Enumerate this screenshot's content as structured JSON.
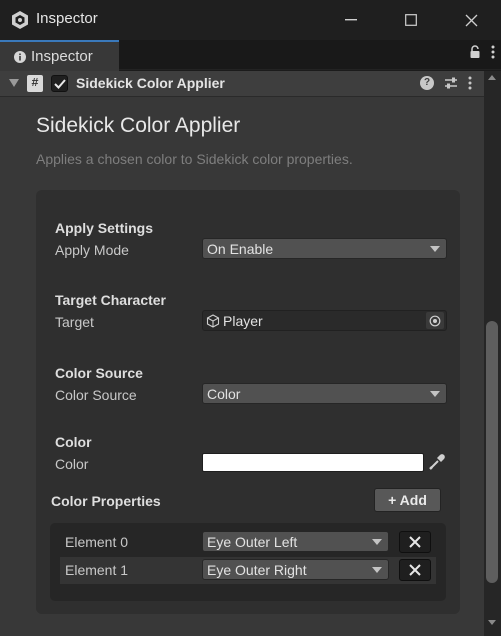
{
  "window": {
    "title": "Inspector",
    "icons": {
      "app": "unity-logo-icon",
      "minimize": "minimize-icon",
      "maximize": "maximize-icon",
      "close": "close-icon"
    }
  },
  "tabbar": {
    "tab_label": "Inspector",
    "tab_icon": "info-icon",
    "tools": [
      "lock-icon",
      "more-vertical-icon"
    ]
  },
  "component": {
    "name": "Sidekick Color Applier",
    "enabled": true,
    "script_icon_glyph": "#",
    "header_icons": [
      "help-icon",
      "preset-icon",
      "more-vertical-icon"
    ],
    "help_glyph": "?"
  },
  "editor": {
    "title": "Sidekick Color Applier",
    "description": "Applies a chosen color to Sidekick color properties.",
    "sections": {
      "apply_settings": {
        "title": "Apply Settings",
        "label": "Apply Mode",
        "value": "On Enable"
      },
      "target_character": {
        "title": "Target Character",
        "label": "Target",
        "value": "Player"
      },
      "color_source": {
        "title": "Color Source",
        "label": "Color Source",
        "value": "Color"
      },
      "color": {
        "title": "Color",
        "label": "Color",
        "swatch_color": "#ffffff"
      }
    },
    "color_properties": {
      "title": "Color Properties",
      "add_label": "+ Add",
      "elements": [
        {
          "label": "Element 0",
          "value": "Eye Outer Left"
        },
        {
          "label": "Element 1",
          "value": "Eye Outer Right"
        }
      ]
    }
  },
  "colors": {
    "accent_tab": "#3a79bb",
    "panel_bg": "#383838",
    "section_bg": "#2f2f2f"
  }
}
